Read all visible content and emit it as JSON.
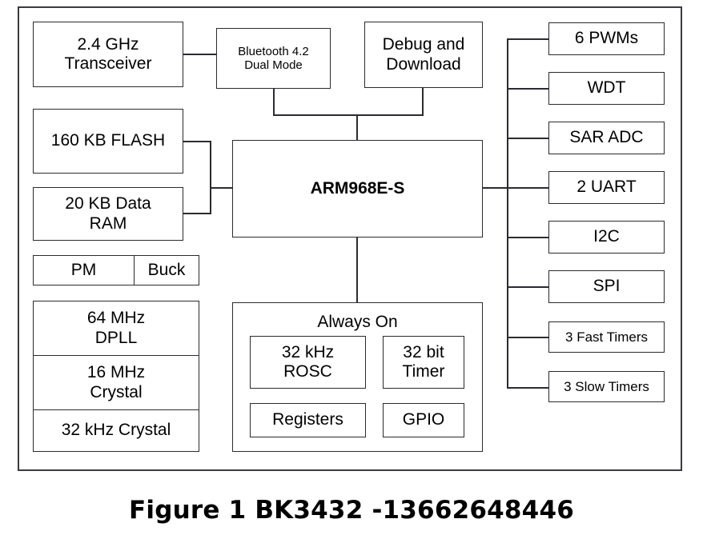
{
  "figure": {
    "caption": "Figure 1 BK3432 -13662648446",
    "colors": {
      "outline": "#2b2b30",
      "chip_border": "#3a3a3f",
      "background": "#ffffff",
      "text": "#000000"
    }
  },
  "blocks": {
    "transceiver": "2.4 GHz\nTransceiver",
    "bluetooth": "Bluetooth 4.2\nDual Mode",
    "debug": "Debug and\nDownload",
    "flash": "160 KB FLASH",
    "data_ram": "20 KB Data\nRAM",
    "cpu": "ARM968E-S",
    "pm": "PM",
    "buck": "Buck"
  },
  "clock_stack": [
    "64 MHz\nDPLL",
    "16 MHz\nCrystal",
    "32 kHz Crystal"
  ],
  "always_on": {
    "title": "Always On",
    "cells": [
      "32 kHz\nROSC",
      "32 bit\nTimer",
      "Registers",
      "GPIO"
    ]
  },
  "peripherals": [
    "6 PWMs",
    "WDT",
    "SAR ADC",
    "2 UART",
    "I2C",
    "SPI",
    "3 Fast Timers",
    "3 Slow Timers"
  ]
}
